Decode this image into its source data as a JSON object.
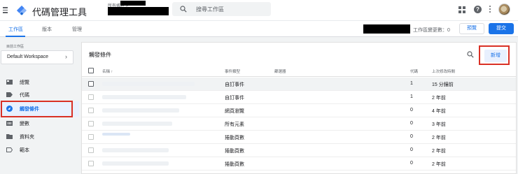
{
  "header": {
    "app_title": "代碼管理工具",
    "account_label": "所有帳戶 >",
    "search_placeholder": "搜尋工作區",
    "help_glyph": "?"
  },
  "subnav": {
    "tabs": [
      {
        "label": "工作區",
        "active": true
      },
      {
        "label": "版本",
        "active": false
      },
      {
        "label": "管理",
        "active": false
      }
    ],
    "workspace_changes_label": "工作區變更數：0",
    "preview_label": "預覽",
    "submit_label": "提交"
  },
  "sidebar": {
    "workspace_label": "目前工作區",
    "workspace_name": "Default Workspace",
    "workspace_chevron": "›",
    "items": [
      {
        "label": "總覽",
        "icon": "overview-icon",
        "active": false
      },
      {
        "label": "代碼",
        "icon": "tag-icon",
        "active": false
      },
      {
        "label": "觸發條件",
        "icon": "trigger-icon",
        "active": true
      },
      {
        "label": "變數",
        "icon": "variables-icon",
        "active": false
      },
      {
        "label": "資料夾",
        "icon": "folder-icon",
        "active": false
      },
      {
        "label": "範本",
        "icon": "template-icon",
        "active": false
      }
    ]
  },
  "main": {
    "title": "觸發條件",
    "new_button_label": "新增",
    "columns": {
      "name": "名稱 ↑",
      "event_type": "事件類型",
      "filter": "篩選器",
      "tags": "代碼",
      "last_edited": "上次修改時間"
    },
    "rows": [
      {
        "event_type": "自訂事件",
        "tags": "1",
        "last_edited": "15 分鐘前",
        "highlighted": true
      },
      {
        "event_type": "自訂事件",
        "tags": "1",
        "last_edited": "2 年前",
        "highlighted": false
      },
      {
        "event_type": "網頁瀏覽",
        "tags": "0",
        "last_edited": "4 年前",
        "highlighted": false
      },
      {
        "event_type": "所有元素",
        "tags": "0",
        "last_edited": "3 年前",
        "highlighted": false
      },
      {
        "event_type": "捲動頁數",
        "tags": "0",
        "last_edited": "2 年前",
        "highlighted": false
      },
      {
        "event_type": "捲動頁數",
        "tags": "0",
        "last_edited": "2 年前",
        "highlighted": false
      },
      {
        "event_type": "捲動頁數",
        "tags": "0",
        "last_edited": "2 年前",
        "highlighted": false
      }
    ]
  },
  "colors": {
    "accent": "#1a73e8",
    "highlight_box": "#d93025",
    "redaction": "#000000"
  }
}
